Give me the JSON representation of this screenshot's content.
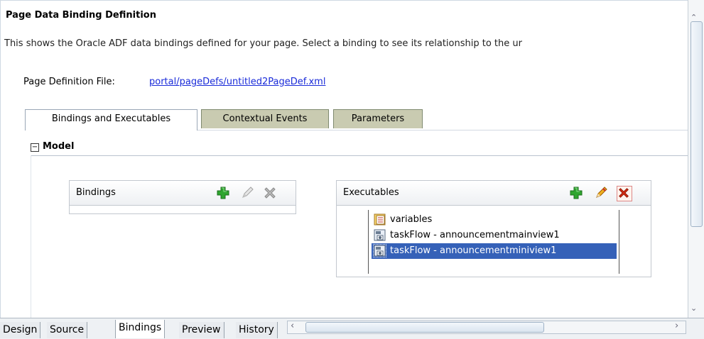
{
  "header": {
    "title": "Page Data Binding Definition",
    "description": "This shows the Oracle ADF data bindings defined for your page. Select a binding to see its relationship to the ur"
  },
  "page_definition": {
    "label": "Page Definition File:",
    "link": "portal/pageDefs/untitled2PageDef.xml"
  },
  "tabs": [
    {
      "label": "Bindings and Executables",
      "active": true
    },
    {
      "label": "Contextual Events",
      "active": false
    },
    {
      "label": "Parameters",
      "active": false
    }
  ],
  "model": {
    "toggle": "−",
    "label": "Model"
  },
  "bindings_panel": {
    "title": "Bindings",
    "icons": [
      "add-icon",
      "edit-icon",
      "delete-icon"
    ]
  },
  "executables_panel": {
    "title": "Executables",
    "icons": [
      "add-icon",
      "edit-icon",
      "delete-icon"
    ],
    "items": [
      {
        "label": "variables",
        "icon": "variables-icon",
        "selected": false
      },
      {
        "label": "taskFlow - announcementmainview1",
        "icon": "taskflow-icon",
        "selected": false
      },
      {
        "label": "taskFlow - announcementminiview1",
        "icon": "taskflow-icon",
        "selected": true
      }
    ]
  },
  "bottom_tabs": [
    {
      "label": "Design",
      "active": false
    },
    {
      "label": "Source",
      "active": false
    },
    {
      "label": "Bindings",
      "active": true
    },
    {
      "label": "Preview",
      "active": false
    },
    {
      "label": "History",
      "active": false
    }
  ],
  "colors": {
    "link": "#1a2bd9",
    "selection": "#3561b8",
    "inactive_tab": "#c9cbb1",
    "add_green": "#2fa52f",
    "delete_red": "#d62b10"
  }
}
